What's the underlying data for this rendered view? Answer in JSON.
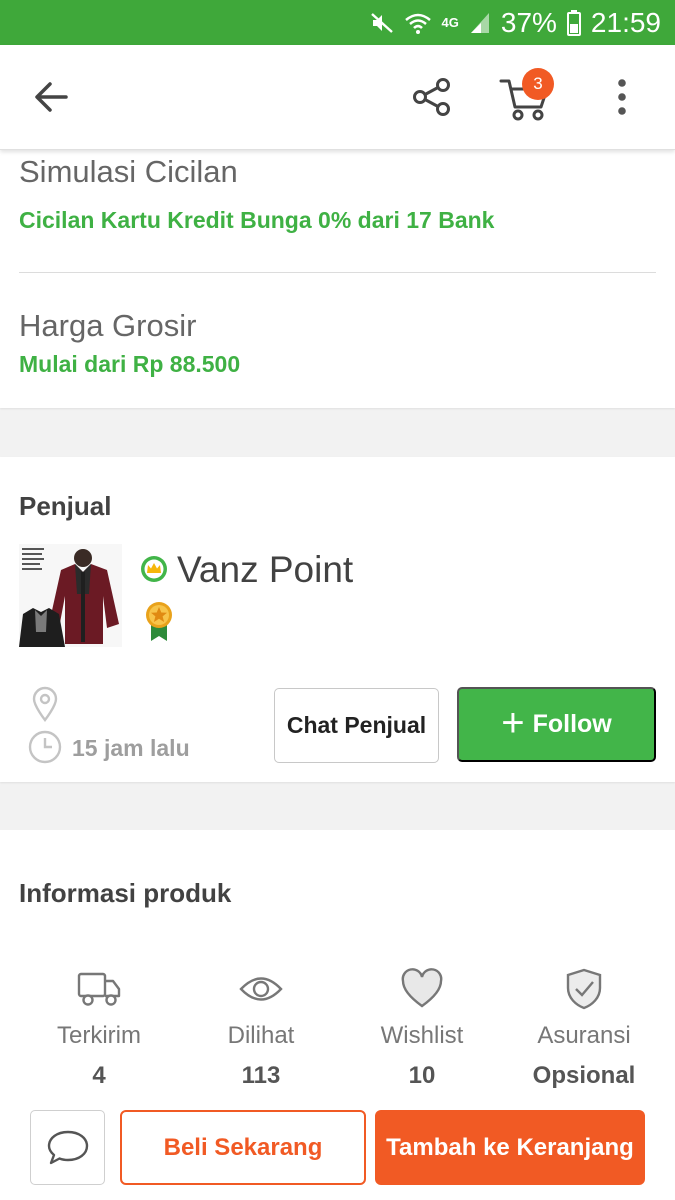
{
  "status_bar": {
    "network": "4G",
    "battery": "37%",
    "time": "21:59"
  },
  "app_bar": {
    "cart_count": "3",
    "icons": [
      "back-arrow-icon",
      "share-icon",
      "cart-icon",
      "more-vert-icon"
    ]
  },
  "installments": {
    "title": "Simulasi Cicilan",
    "subtitle": "Cicilan Kartu Kredit Bunga 0% dari 17 Bank"
  },
  "wholesale": {
    "title": "Harga Grosir",
    "subtitle": "Mulai dari Rp 88.500"
  },
  "seller": {
    "section_title": "Penjual",
    "shop_name": "Vanz Point",
    "last_online": "15 jam lalu",
    "chat_label": "Chat Penjual",
    "follow_label": "Follow"
  },
  "product_info": {
    "title": "Informasi produk",
    "stats": [
      {
        "label": "Terkirim",
        "value": "4",
        "icon": "truck-icon"
      },
      {
        "label": "Dilihat",
        "value": "113",
        "icon": "eye-icon"
      },
      {
        "label": "Wishlist",
        "value": "10",
        "icon": "heart-icon"
      },
      {
        "label": "Asuransi",
        "value": "Opsional",
        "icon": "shield-check-icon"
      }
    ]
  },
  "bottom_bar": {
    "buy_now_label": "Beli Sekarang",
    "add_to_cart_label": "Tambah ke Keranjang"
  },
  "colors": {
    "primary_green": "#42b549",
    "status_bar_green": "#3fa83a",
    "accent_orange": "#f15a24",
    "text_green": "#3fb144"
  }
}
